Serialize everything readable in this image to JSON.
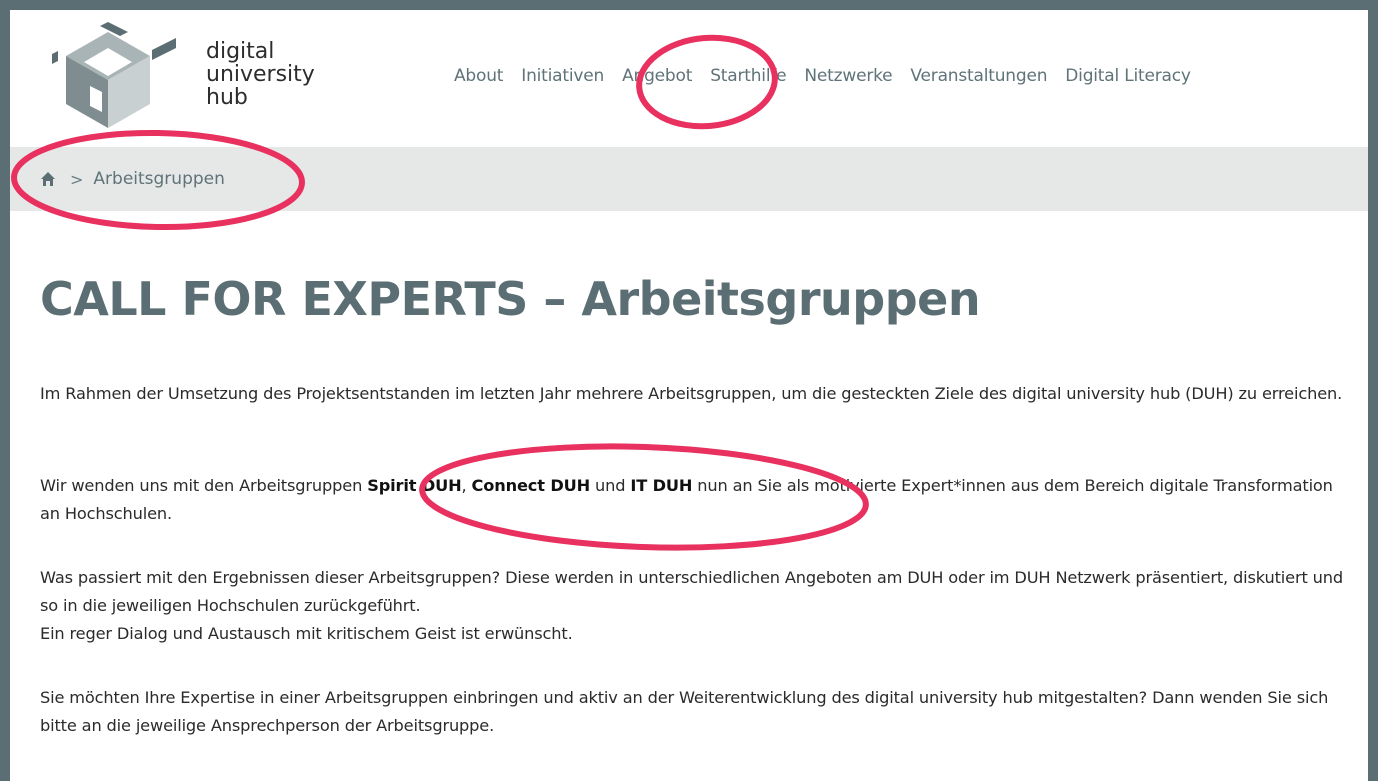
{
  "logo": {
    "lines": [
      "digital",
      "university",
      "hub"
    ]
  },
  "nav": [
    "About",
    "Initiativen",
    "Angebot",
    "Starthilfe",
    "Netzwerke",
    "Veranstaltungen",
    "Digital Literacy"
  ],
  "breadcrumb": {
    "separator": ">",
    "current": "Arbeitsgruppen"
  },
  "page": {
    "title": "CALL FOR EXPERTS – Arbeitsgruppen",
    "p1": "Im Rahmen der Umsetzung des Projektsentstanden im letzten Jahr mehrere Arbeitsgruppen, um die gesteckten Ziele des digital university hub (DUH) zu erreichen.",
    "p2": {
      "a": "Wir wenden uns mit den Arbeitsgruppen ",
      "b1": "Spirit DUH",
      "c": ", ",
      "b2": "Connect DUH",
      "d": " und ",
      "b3": "IT DUH",
      "e": " nun an Sie als motivierte Expert*innen aus dem Bereich digitale Transformation an Hochschulen."
    },
    "p3a": "Was passiert mit den Ergebnissen dieser Arbeitsgruppen? Diese werden in unterschiedlichen Angeboten am DUH oder im DUH Netzwerk präsentiert, diskutiert und so in die jeweiligen Hochschulen zurückgeführt.",
    "p3b": "Ein reger Dialog und Austausch mit kritischem Geist ist erwünscht.",
    "p4": "Sie möchten Ihre Expertise in einer Arbeitsgruppen einbringen und aktiv an der Weiterentwicklung des digital university hub mitgestalten? Dann wenden Sie sich bitte an die jeweilige Ansprechperson der Arbeitsgruppe."
  },
  "colors": {
    "frame": "#5b6e73",
    "annotation": "#e8315f",
    "breadcrumb_bg": "#e6e8e8"
  }
}
